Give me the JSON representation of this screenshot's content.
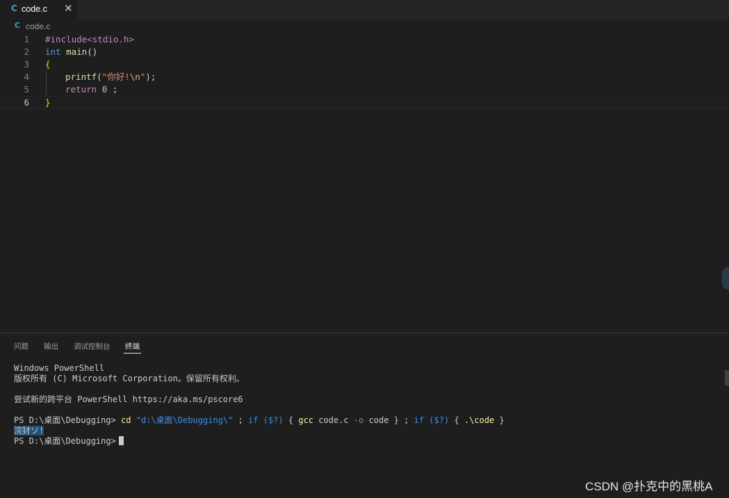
{
  "tab": {
    "icon_letter": "C",
    "label": "code.c",
    "close": "✕"
  },
  "breadcrumb": {
    "icon_letter": "C",
    "label": "code.c"
  },
  "editor": {
    "line_numbers": [
      "1",
      "2",
      "3",
      "4",
      "5",
      "6"
    ],
    "lines": [
      [
        "#include<stdio.h>"
      ],
      [
        "int",
        " ",
        "main",
        "()"
      ],
      [
        "{"
      ],
      [
        "printf",
        "(",
        "\"你好!",
        "\\n",
        "\"",
        ");"
      ],
      [
        "return",
        " ",
        "0",
        " ;"
      ],
      [
        "}"
      ]
    ],
    "current_line": "6"
  },
  "panel": {
    "tabs": [
      "问题",
      "输出",
      "调试控制台",
      "终端"
    ],
    "active_tab": "终端"
  },
  "terminal": {
    "line1": "Windows PowerShell",
    "line2": "版权所有 (C) Microsoft Corporation。保留所有权利。",
    "line3": "尝试新的跨平台 PowerShell https://aka.ms/pscore6",
    "prompt": "PS D:\\桌面\\Debugging>",
    "cmd_cd": "cd",
    "cmd_path": "\"d:\\桌面\\Debugging\\\"",
    "cmd_sep1": ";",
    "cmd_if1": "if",
    "cmd_cond1": "($?)",
    "cmd_brace_open1": "{",
    "cmd_gcc": "gcc",
    "cmd_src": "code.c",
    "cmd_flag": "-o",
    "cmd_out": "code",
    "cmd_brace_close1": "}",
    "cmd_sep2": ";",
    "cmd_if2": "if",
    "cmd_cond2": "($?)",
    "cmd_brace_open2": "{",
    "cmd_run": ".\\code",
    "cmd_brace_close2": "}",
    "output": "浣犲ソ!",
    "prompt2": "PS D:\\桌面\\Debugging>"
  },
  "watermark": "CSDN @扑克中的黑桃A"
}
